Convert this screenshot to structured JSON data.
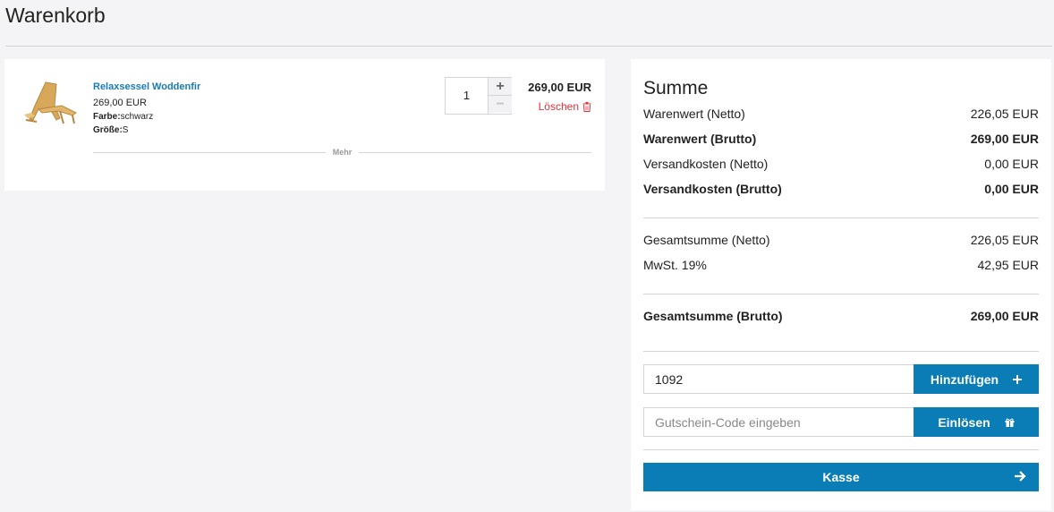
{
  "page": {
    "title": "Warenkorb"
  },
  "cart": {
    "item": {
      "name": "Relaxsessel Woddenfir",
      "unit_price": "269,00 EUR",
      "color_label": "Farbe:",
      "color_value": "schwarz",
      "size_label": "Größe:",
      "size_value": "S",
      "quantity": "1",
      "plus_label": "+",
      "minus_label": "−",
      "line_total": "269,00 EUR",
      "delete_label": "Löschen",
      "thumb_icon": "armchair-image"
    },
    "more_label": "Mehr"
  },
  "summary": {
    "title": "Summe",
    "rows": [
      {
        "label": "Warenwert (Netto)",
        "value": "226,05 EUR"
      },
      {
        "label": "Warenwert (Brutto)",
        "value": "269,00 EUR"
      },
      {
        "label": "Versandkosten (Netto)",
        "value": "0,00 EUR"
      },
      {
        "label": "Versandkosten (Brutto)",
        "value": "0,00 EUR"
      },
      {
        "label": "Gesamtsumme (Netto)",
        "value": "226,05 EUR"
      },
      {
        "label": "MwSt. 19%",
        "value": "42,95 EUR"
      },
      {
        "label": "Gesamtsumme (Brutto)",
        "value": "269,00 EUR"
      }
    ],
    "add_field_value": "1092",
    "add_button_label": "Hinzufügen",
    "voucher_placeholder": "Gutschein-Code eingeben",
    "voucher_button_label": "Einlösen",
    "checkout_label": "Kasse"
  },
  "colors": {
    "accent": "#0a7db7",
    "link": "#1a7ab3",
    "danger": "#e0303a",
    "background": "#f4f4f6"
  }
}
